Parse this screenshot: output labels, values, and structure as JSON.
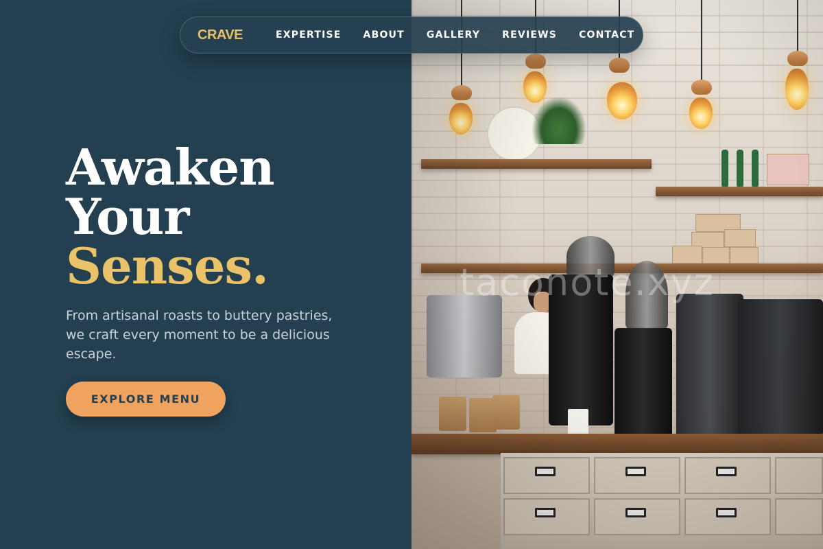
{
  "nav": {
    "brand": "CRAVE",
    "links": [
      "EXPERTISE",
      "ABOUT",
      "GALLERY",
      "REVIEWS",
      "CONTACT"
    ]
  },
  "hero": {
    "title_line1": "Awaken",
    "title_line2": "Your",
    "title_accent": "Senses.",
    "subtitle": "From artisanal roasts to buttery pastries, we craft every moment to be a delicious escape.",
    "cta_label": "EXPLORE MENU"
  },
  "photo": {
    "watermark": "taconote.xyz"
  },
  "colors": {
    "background": "#233f50",
    "accent_gold": "#e9c26a",
    "cta_orange": "#efa35e",
    "text_light": "#ffffff"
  }
}
